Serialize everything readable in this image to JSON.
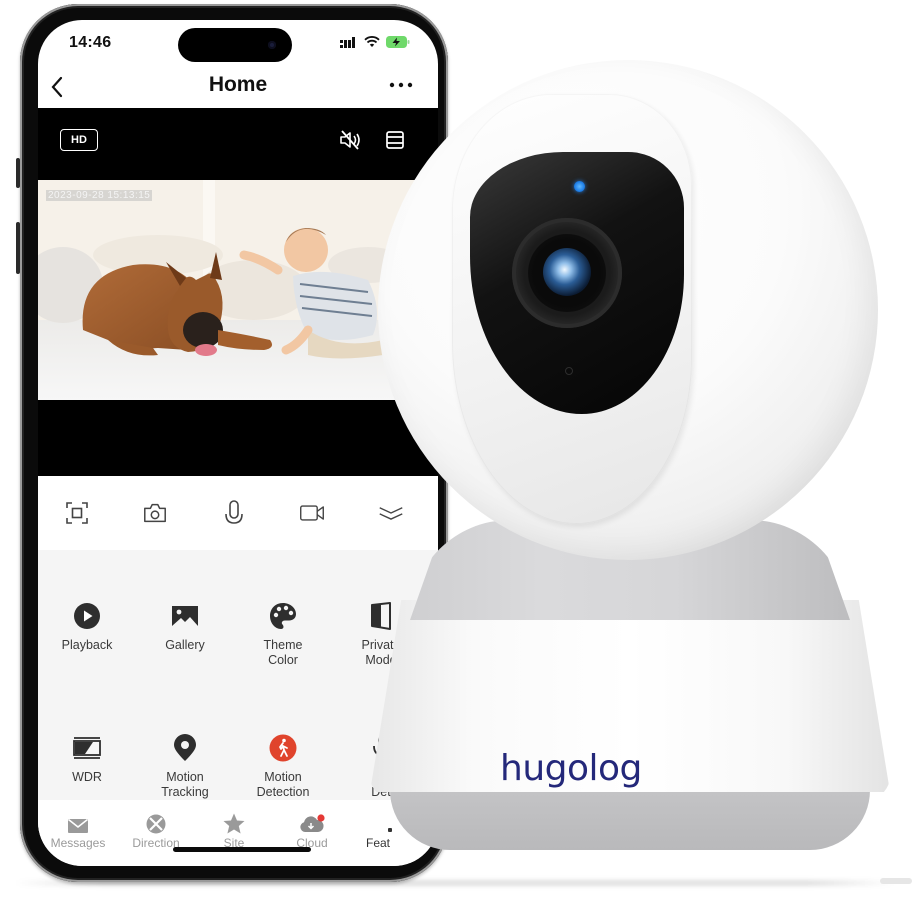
{
  "status_bar": {
    "time": "14:46",
    "battery_color": "#4cd964"
  },
  "nav": {
    "back_icon": "chevron-left-icon",
    "back_glyph": "‹",
    "title": "Home",
    "more_glyph": "···"
  },
  "live_view": {
    "quality_badge": "HD",
    "timestamp": "2023-09-28 15:13:15"
  },
  "controls": [
    {
      "name": "fullscreen",
      "icon": "fullscreen-icon"
    },
    {
      "name": "snapshot",
      "icon": "camera-icon"
    },
    {
      "name": "talk",
      "icon": "microphone-icon"
    },
    {
      "name": "record",
      "icon": "video-camera-icon"
    },
    {
      "name": "collapse",
      "icon": "double-chevron-down-icon"
    }
  ],
  "features": [
    {
      "label": "Playback",
      "icon": "play-circle-icon"
    },
    {
      "label": "Gallery",
      "icon": "image-icon"
    },
    {
      "label": "Theme\nColor",
      "icon": "palette-icon"
    },
    {
      "label": "Private\nMode",
      "icon": "shield-half-icon"
    },
    {
      "label": "WDR",
      "icon": "wdr-icon"
    },
    {
      "label": "Motion\nTracking",
      "icon": "location-pin-icon"
    },
    {
      "label": "Motion\nDetection",
      "icon": "walking-person-icon",
      "color": "#e0442c"
    },
    {
      "label": "So\nDet",
      "icon": "sound-detection-icon"
    }
  ],
  "tabs": [
    {
      "label": "Messages",
      "icon": "envelope-icon",
      "active": false
    },
    {
      "label": "Direction",
      "icon": "direction-pad-icon",
      "active": false
    },
    {
      "label": "Site",
      "icon": "star-icon",
      "active": false
    },
    {
      "label": "Cloud",
      "icon": "cloud-icon",
      "active": false,
      "badge": true,
      "badge_color": "#e53935"
    },
    {
      "label": "Feat",
      "icon": "features-icon",
      "active": true
    }
  ],
  "product": {
    "brand": "hugolog",
    "brand_color": "#24287a",
    "led_color": "#1f7fe8"
  }
}
